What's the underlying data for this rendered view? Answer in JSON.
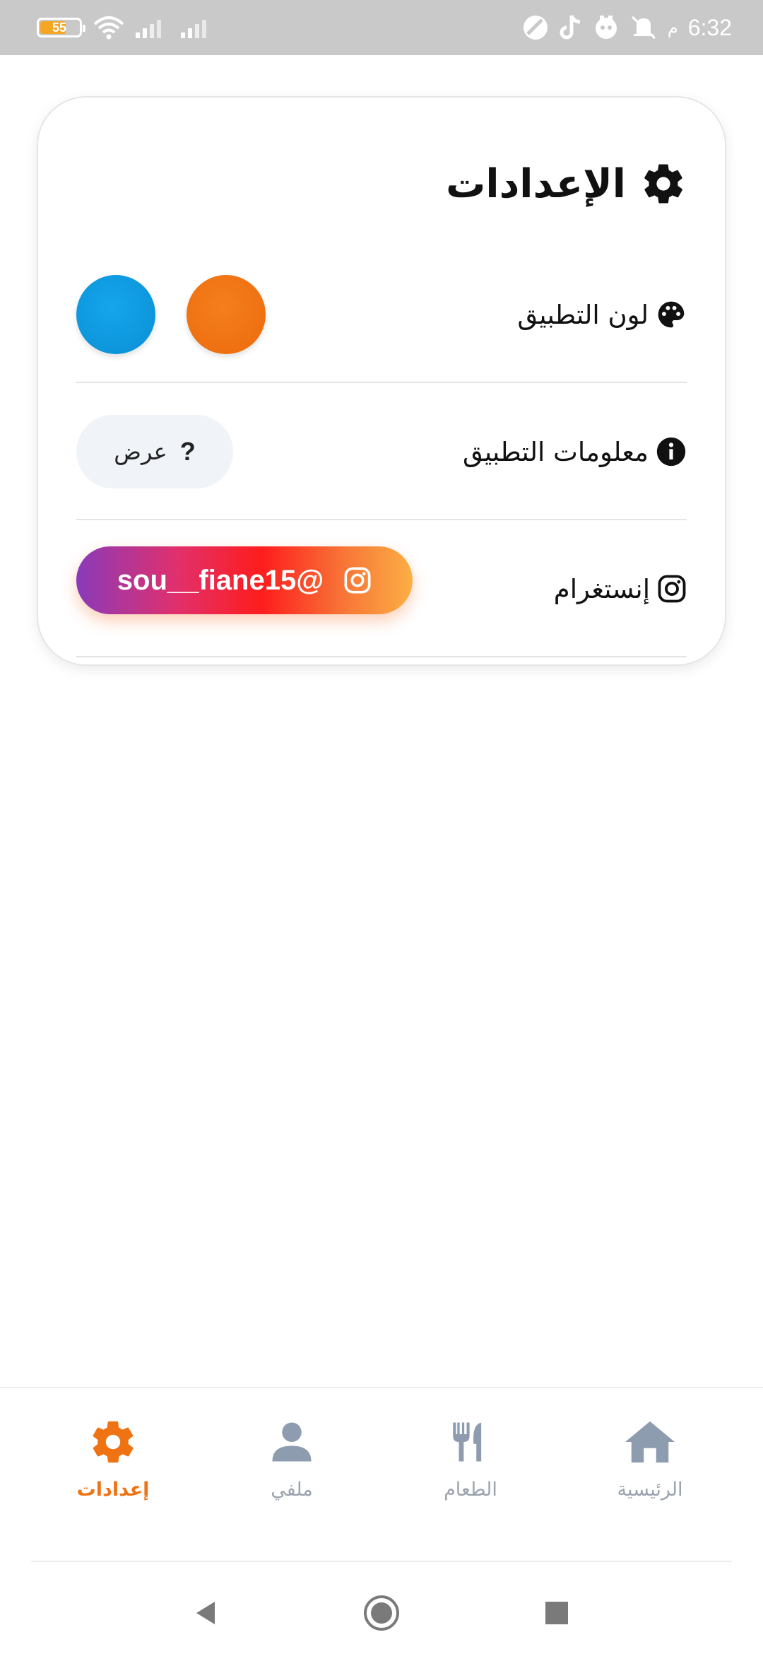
{
  "status_bar": {
    "battery_level": "55",
    "time": "6:32",
    "ampm": "م",
    "icons": [
      "battery-icon",
      "wifi-icon",
      "signal-icon",
      "signal-icon",
      "app-icon",
      "tiktok-icon",
      "notification-icon",
      "mute-icon"
    ]
  },
  "settings": {
    "title": "الإعدادات",
    "rows": {
      "app_color": {
        "label": "لون التطبيق",
        "colors": [
          "#f07313",
          "#0b97dc"
        ]
      },
      "app_info": {
        "label": "معلومات التطبيق",
        "button_label": "عرض",
        "button_symbol": "?"
      },
      "instagram": {
        "label": "إنستغرام",
        "handle": "sou__fiane15@"
      }
    }
  },
  "bottom_nav": {
    "items": [
      {
        "label": "إعدادات",
        "icon": "gear-icon",
        "active": true
      },
      {
        "label": "ملفي",
        "icon": "user-icon",
        "active": false
      },
      {
        "label": "الطعام",
        "icon": "utensils-icon",
        "active": false
      },
      {
        "label": "الرئيسية",
        "icon": "home-icon",
        "active": false
      }
    ],
    "active_color": "#f07313",
    "inactive_color": "#8e9cb0"
  }
}
